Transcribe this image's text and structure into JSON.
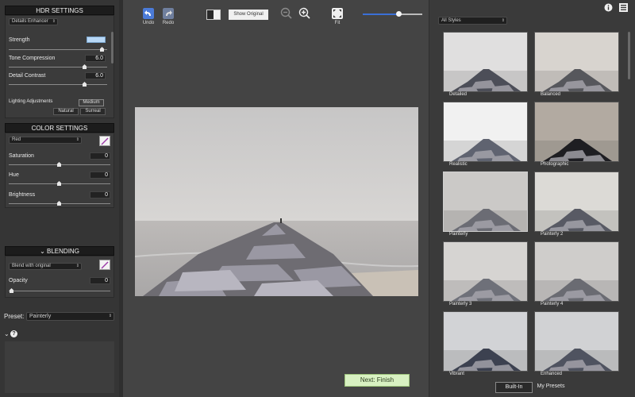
{
  "hdr": {
    "title": "HDR SETTINGS",
    "preset_dropdown": "Details Enhancer",
    "strength_label": "Strength",
    "tone_label": "Tone Compression",
    "tone_value": "6.0",
    "detail_label": "Detail Contrast",
    "detail_value": "6.0",
    "lighting_label": "Lighting Adjustments",
    "lighting_medium": "Medium",
    "lighting_natural": "Natural",
    "lighting_surreal": "Surreal"
  },
  "color": {
    "title": "COLOR SETTINGS",
    "channel_dropdown": "Red",
    "saturation_label": "Saturation",
    "saturation_value": "0",
    "hue_label": "Hue",
    "hue_value": "0",
    "brightness_label": "Brightness",
    "brightness_value": "0"
  },
  "blending": {
    "title": "BLENDING",
    "mode_dropdown": "Blend with original",
    "opacity_label": "Opacity",
    "opacity_value": "0"
  },
  "preset": {
    "label": "Preset:",
    "value": "Painterly"
  },
  "toolbar": {
    "undo": "Undo",
    "redo": "Redo",
    "show_original": "Show Original",
    "fit": "Fit",
    "zoom_level": 0.6
  },
  "next_button": "Next: Finish",
  "styles": {
    "filter": "All Styles",
    "items": [
      {
        "label": "Detailed"
      },
      {
        "label": "Balanced"
      },
      {
        "label": "Realistic"
      },
      {
        "label": "Photographic"
      },
      {
        "label": "Painterly"
      },
      {
        "label": "Painterly 2"
      },
      {
        "label": "Painterly 3"
      },
      {
        "label": "Painterly 4"
      },
      {
        "label": "Vibrant"
      },
      {
        "label": "Enhanced"
      }
    ],
    "selected": "Painterly",
    "tab_builtin": "Built-In",
    "tab_mypresets": "My Presets"
  },
  "colors": {
    "next_bg": "#d8f1c2",
    "slider_blue": "#3b6fd6"
  }
}
